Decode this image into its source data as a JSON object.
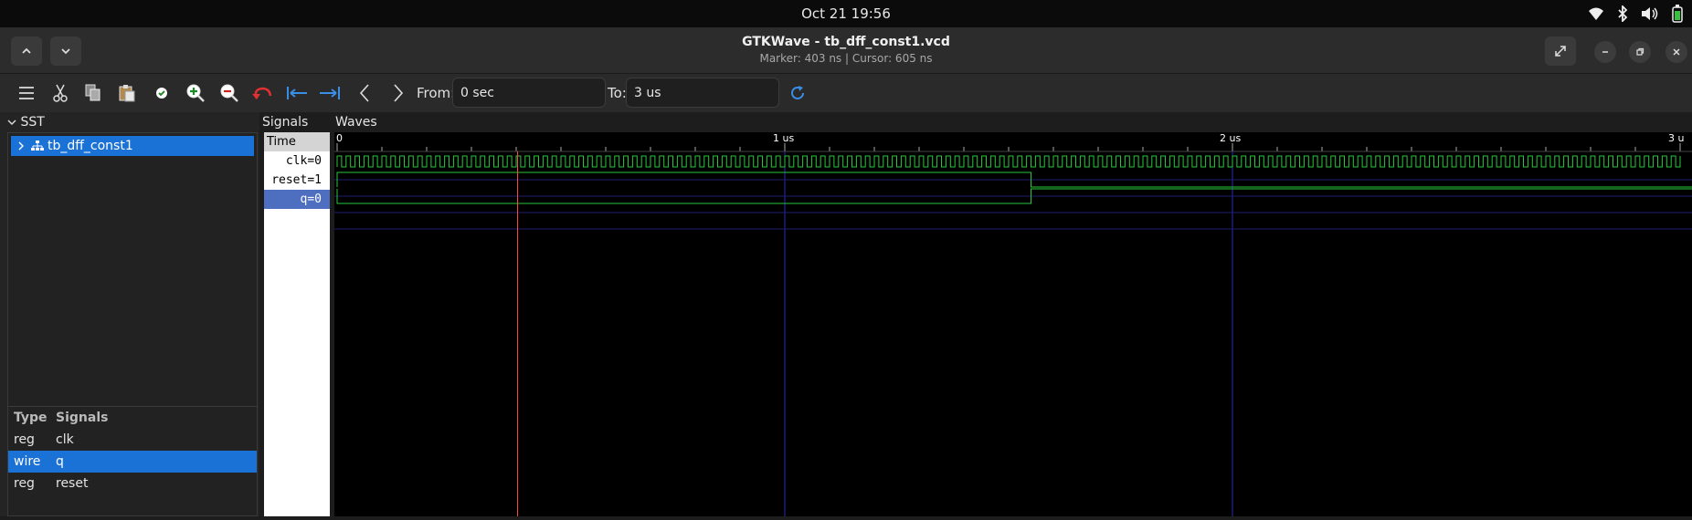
{
  "system_bar": {
    "clock": "Oct 21  19:56"
  },
  "window": {
    "title": "GTKWave - tb_dff_const1.vcd",
    "subtitle": "Marker: 403 ns  |  Cursor: 605 ns"
  },
  "toolbar": {
    "from_label": "From:",
    "from_value": "0 sec",
    "to_label": "To:",
    "to_value": "3 us"
  },
  "sst": {
    "header": "SST",
    "tree_item": "tb_dff_const1"
  },
  "signal_list": {
    "col_type": "Type",
    "col_signals": "Signals",
    "rows": [
      {
        "type": "reg",
        "name": "clk"
      },
      {
        "type": "wire",
        "name": "q"
      },
      {
        "type": "reg",
        "name": "reset"
      }
    ]
  },
  "signals_pane": {
    "header": "Signals",
    "time_label": "Time",
    "rows": [
      "clk=0",
      "reset=1",
      "q=0"
    ]
  },
  "waves_pane": {
    "header": "Waves",
    "ruler_ticks": [
      "0",
      "1 us",
      "2 us",
      "3 u"
    ],
    "marker_ns": 403,
    "reset_release_ns": 1550,
    "clk_period_ns": 20,
    "time_end_ns": 3000
  },
  "colors": {
    "selection": "#1b72d6",
    "wave_green": "#27c83b",
    "marker_red": "#ff4a4a",
    "grid_blue": "#2a2ab8"
  }
}
